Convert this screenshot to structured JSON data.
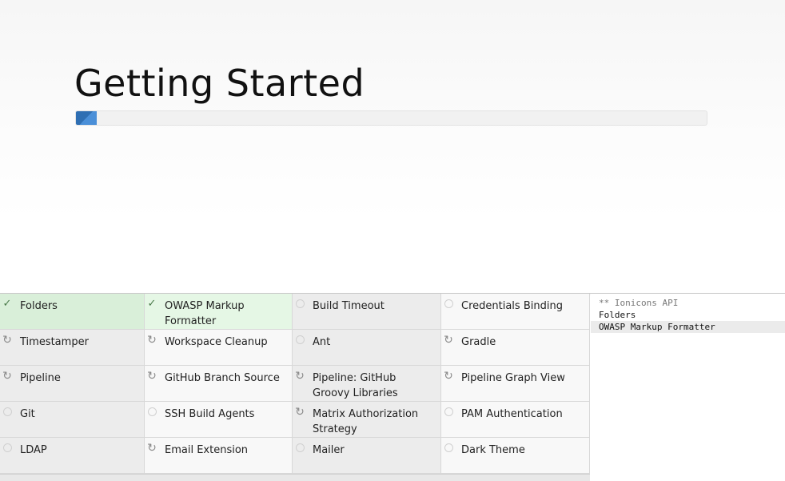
{
  "header": {
    "title": "Getting Started",
    "progress_percent": 3.3,
    "progress_color": "#2f6fb3"
  },
  "plugins": [
    {
      "name": "Folders",
      "status": "success",
      "icon": "check-icon"
    },
    {
      "name": "OWASP Markup Formatter",
      "status": "success",
      "icon": "check-icon"
    },
    {
      "name": "Build Timeout",
      "status": "pending",
      "icon": "circle-icon"
    },
    {
      "name": "Credentials Binding",
      "status": "pending",
      "icon": "circle-icon"
    },
    {
      "name": "Timestamper",
      "status": "installing",
      "icon": "refresh-icon"
    },
    {
      "name": "Workspace Cleanup",
      "status": "pending",
      "icon": "refresh-icon"
    },
    {
      "name": "Ant",
      "status": "pending",
      "icon": "circle-icon"
    },
    {
      "name": "Gradle",
      "status": "pending",
      "icon": "refresh-icon"
    },
    {
      "name": "Pipeline",
      "status": "installing",
      "icon": "refresh-icon"
    },
    {
      "name": "GitHub Branch Source",
      "status": "pending",
      "icon": "refresh-icon"
    },
    {
      "name": "Pipeline: GitHub Groovy Libraries",
      "status": "installing",
      "icon": "refresh-icon"
    },
    {
      "name": "Pipeline Graph View",
      "status": "pending",
      "icon": "refresh-icon"
    },
    {
      "name": "Git",
      "status": "installing",
      "icon": "circle-icon"
    },
    {
      "name": "SSH Build Agents",
      "status": "pending",
      "icon": "circle-icon"
    },
    {
      "name": "Matrix Authorization Strategy",
      "status": "installing",
      "icon": "refresh-icon"
    },
    {
      "name": "PAM Authentication",
      "status": "pending",
      "icon": "circle-icon"
    },
    {
      "name": "LDAP",
      "status": "installing",
      "icon": "circle-icon"
    },
    {
      "name": "Email Extension",
      "status": "pending",
      "icon": "refresh-icon"
    },
    {
      "name": "Mailer",
      "status": "installing",
      "icon": "circle-icon"
    },
    {
      "name": "Dark Theme",
      "status": "pending",
      "icon": "circle-icon"
    }
  ],
  "log": {
    "lines": [
      "** Ionicons API",
      "Folders",
      "OWASP Markup Formatter"
    ]
  }
}
